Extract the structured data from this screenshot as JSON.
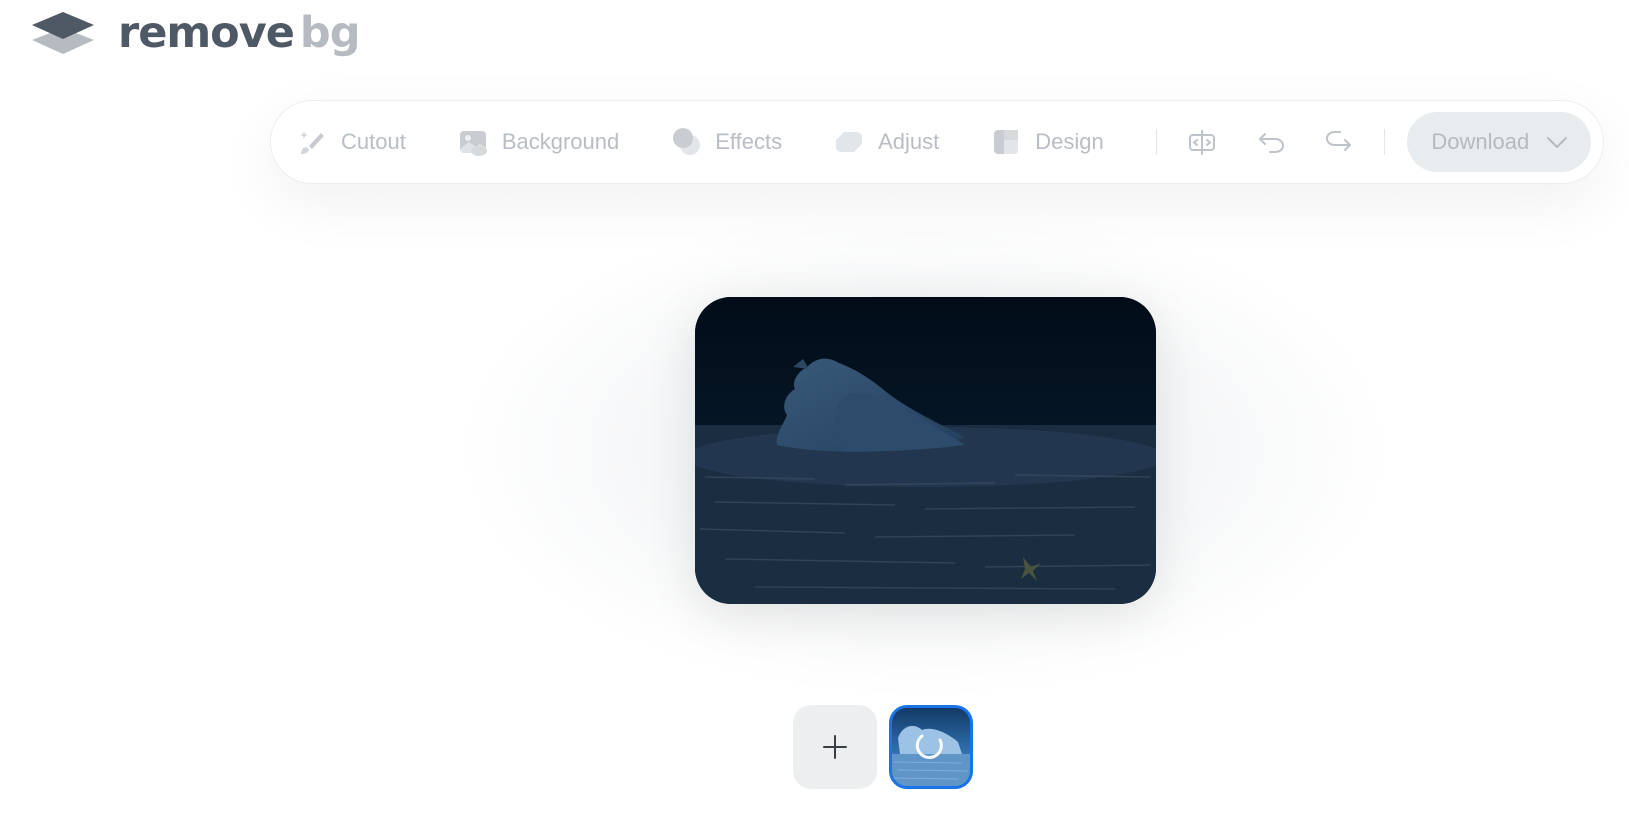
{
  "logo": {
    "word_remove": "remove",
    "word_bg": "bg",
    "icon": "layers-logo-icon"
  },
  "toolbar": {
    "tools": [
      {
        "label": "Cutout",
        "icon": "brush-sparkle-icon"
      },
      {
        "label": "Background",
        "icon": "image-icon"
      },
      {
        "label": "Effects",
        "icon": "circles-icon"
      },
      {
        "label": "Adjust",
        "icon": "adjust-square-icon"
      },
      {
        "label": "Design",
        "icon": "design-layout-icon"
      }
    ],
    "compare_icon": "compare-icon",
    "undo_icon": "undo-icon",
    "redo_icon": "redo-icon",
    "download": {
      "label": "Download",
      "icon": "chevron-down-icon"
    }
  },
  "thumbnails": {
    "add_icon": "plus-icon",
    "loading_icon": "spinner-icon"
  },
  "colors": {
    "logo_dark": "#4f5966",
    "logo_light": "#b6bbc1",
    "disabled_text": "#b9bec4",
    "selected_border": "#1a73e8",
    "download_bg": "#e9ecef"
  }
}
